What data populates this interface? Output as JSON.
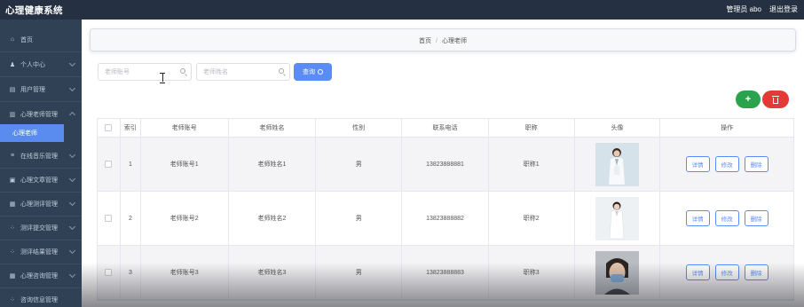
{
  "app": {
    "title": "心理健康系统",
    "user_label": "管理员 abo",
    "logout": "退出登录"
  },
  "sidebar": {
    "items": [
      {
        "label": "首页",
        "icon": "home-icon"
      },
      {
        "label": "个人中心",
        "icon": "user-icon"
      },
      {
        "label": "用户管理",
        "icon": "grid-icon"
      },
      {
        "label": "心理老师管理",
        "icon": "grid-icon"
      },
      {
        "label": "心理老师",
        "icon": ""
      },
      {
        "label": "在线音乐管理",
        "icon": "menu-icon"
      },
      {
        "label": "心理文章管理",
        "icon": "book-icon"
      },
      {
        "label": "心理测评管理",
        "icon": "list-icon"
      },
      {
        "label": "测评提交管理",
        "icon": "apps-icon"
      },
      {
        "label": "测评结果管理",
        "icon": "apps-icon"
      },
      {
        "label": "心理咨询管理",
        "icon": "list-icon"
      },
      {
        "label": "咨询信息管理",
        "icon": "apps-icon"
      }
    ]
  },
  "breadcrumb": {
    "home": "首页",
    "sep": "/",
    "current": "心理老师"
  },
  "search": {
    "account_placeholder": "老师账号",
    "name_placeholder": "老师姓名",
    "button": "查询"
  },
  "actions": {
    "add": "+"
  },
  "table": {
    "headers": [
      "索引",
      "老师账号",
      "老师姓名",
      "性别",
      "联系电话",
      "职称",
      "头像",
      "操作"
    ],
    "rows": [
      {
        "index": "1",
        "account": "老师账号1",
        "name": "老师姓名1",
        "sex": "男",
        "phone": "13823888881",
        "title": "职称1"
      },
      {
        "index": "2",
        "account": "老师账号2",
        "name": "老师姓名2",
        "sex": "男",
        "phone": "13823888882",
        "title": "职称2"
      },
      {
        "index": "3",
        "account": "老师账号3",
        "name": "老师姓名3",
        "sex": "男",
        "phone": "13823888883",
        "title": "职称3"
      }
    ],
    "ops": {
      "detail": "详情",
      "edit": "修改",
      "delete": "删除"
    }
  },
  "colors": {
    "sidebar_bg": "#304156",
    "topbar_bg": "#253142",
    "accent": "#5b8cf5",
    "add": "#2ba24c",
    "danger": "#e23b36"
  }
}
